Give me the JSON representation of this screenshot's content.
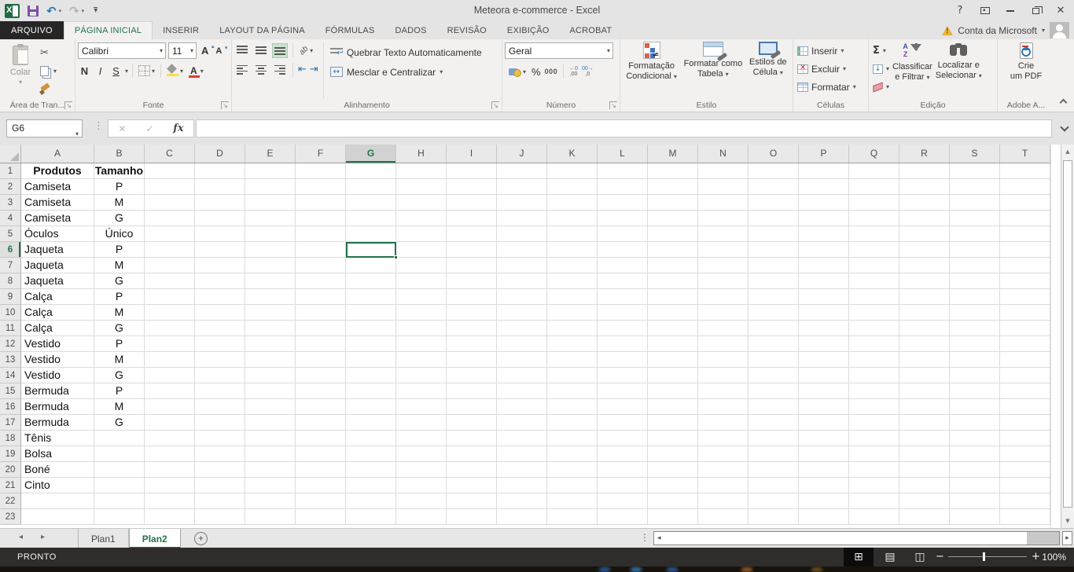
{
  "window": {
    "title": "Meteora e-commerce - Excel"
  },
  "tabs": {
    "file": "ARQUIVO",
    "items": [
      "PÁGINA INICIAL",
      "INSERIR",
      "LAYOUT DA PÁGINA",
      "FÓRMULAS",
      "DADOS",
      "REVISÃO",
      "EXIBIÇÃO",
      "ACROBAT"
    ],
    "active": "PÁGINA INICIAL"
  },
  "account": {
    "label": "Conta da Microsoft"
  },
  "ribbon": {
    "clipboard": {
      "paste": "Colar",
      "label": "Área de Tran..."
    },
    "font": {
      "family": "Calibri",
      "size": "11",
      "grow": "A",
      "shrink": "A",
      "bold": "N",
      "italic": "I",
      "underline": "S",
      "label": "Fonte"
    },
    "alignment": {
      "wrap": "Quebrar Texto Automaticamente",
      "merge": "Mesclar e Centralizar",
      "label": "Alinhamento"
    },
    "number": {
      "format": "Geral",
      "percent": "%",
      "thousands": "000",
      "dec1a": "←0",
      "dec1b": ",00",
      "dec2a": "00→",
      "dec2b": ",0",
      "label": "Número"
    },
    "style": {
      "conditional": [
        "Formatação",
        "Condicional"
      ],
      "table": [
        "Formatar como",
        "Tabela"
      ],
      "cell": [
        "Estilos de",
        "Célula"
      ],
      "label": "Estilo"
    },
    "cells": {
      "insert": "Inserir",
      "delete": "Excluir",
      "format": "Formatar",
      "label": "Células"
    },
    "editing": {
      "sort": [
        "Classificar",
        "e Filtrar"
      ],
      "find": [
        "Localizar e",
        "Selecionar"
      ],
      "sort_a": "A",
      "sort_z": "Z",
      "label": "Edição"
    },
    "adobe": {
      "button": [
        "Crie",
        "um PDF"
      ],
      "label": "Adobe A..."
    }
  },
  "formula_bar": {
    "name_box": "G6",
    "fx": "fx"
  },
  "sheet": {
    "columns": [
      "A",
      "B",
      "C",
      "D",
      "E",
      "F",
      "G",
      "H",
      "I",
      "J",
      "K",
      "L",
      "M",
      "N",
      "O",
      "P",
      "Q",
      "R",
      "S",
      "T"
    ],
    "col_width_a": 93,
    "col_width_default": 64,
    "row_count": 23,
    "selection": {
      "cell": "G6",
      "column": "G",
      "row": 6
    },
    "rows": [
      {
        "A": "Produtos",
        "B": "Tamanho"
      },
      {
        "A": "Camiseta",
        "B": "P"
      },
      {
        "A": "Camiseta",
        "B": "M"
      },
      {
        "A": "Camiseta",
        "B": "G"
      },
      {
        "A": "Óculos",
        "B": "Único"
      },
      {
        "A": "Jaqueta",
        "B": "P"
      },
      {
        "A": "Jaqueta",
        "B": "M"
      },
      {
        "A": "Jaqueta",
        "B": "G"
      },
      {
        "A": "Calça",
        "B": "P"
      },
      {
        "A": "Calça",
        "B": "M"
      },
      {
        "A": "Calça",
        "B": "G"
      },
      {
        "A": "Vestido",
        "B": "P"
      },
      {
        "A": "Vestido",
        "B": "M"
      },
      {
        "A": "Vestido",
        "B": "G"
      },
      {
        "A": "Bermuda",
        "B": "P"
      },
      {
        "A": "Bermuda",
        "B": "M"
      },
      {
        "A": "Bermuda",
        "B": "G"
      },
      {
        "A": "Tênis"
      },
      {
        "A": "Bolsa"
      },
      {
        "A": "Boné"
      },
      {
        "A": "Cinto"
      },
      {},
      {}
    ]
  },
  "sheet_tabs": {
    "items": [
      {
        "label": "Plan1",
        "active": false
      },
      {
        "label": "Plan2",
        "active": true
      }
    ]
  },
  "status_bar": {
    "mode": "PRONTO",
    "zoom_level": "100%"
  },
  "colors": {
    "accent_green": "#217346",
    "file_tab_bg": "#262626",
    "status_bg": "#2e2d2c"
  },
  "icons": {
    "caret": "▾",
    "caret_up": "▴",
    "scissors": "✂",
    "sum": "Σ",
    "check": "✓",
    "cancel": "✕",
    "close": "✕",
    "help": "?",
    "dots_v": "⋮",
    "left": "◂",
    "right": "▸",
    "up": "▲",
    "down": "▼",
    "wrap_arrow": "↩",
    "merge_arrow": "↔",
    "indent_left": "⇤",
    "indent_right": "⇥",
    "not_equal": "≠",
    "launcher_arrow": "↘",
    "view_normal": "⊞",
    "view_layout": "▤",
    "view_break": "◫",
    "plus": "+",
    "minus": "−",
    "fill_down": "↓",
    "orientation": "ab",
    "delete_x": "✕",
    "undo": "↶",
    "redo": "↷"
  }
}
